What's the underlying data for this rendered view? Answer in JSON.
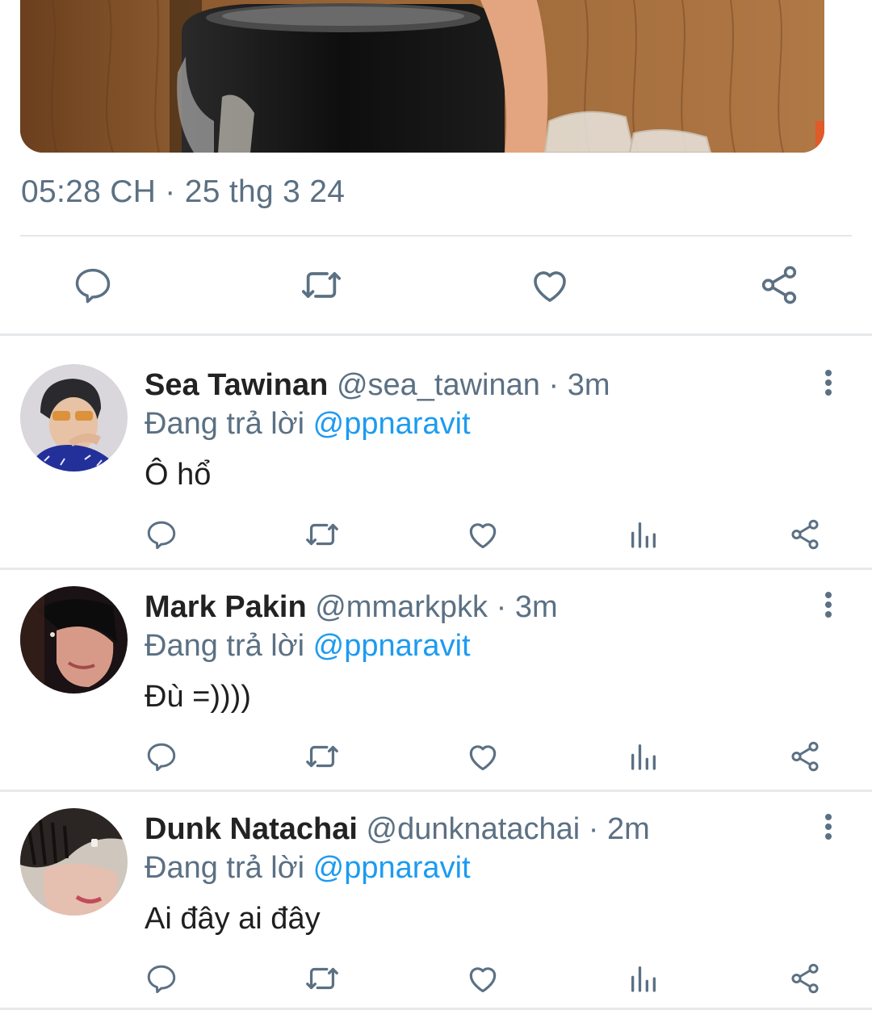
{
  "tweet": {
    "timestamp": "05:28 CH · 25 thg 3 24",
    "actions": [
      "reply-icon",
      "retweet-icon",
      "like-icon",
      "share-icon"
    ]
  },
  "replies": [
    {
      "name": "Sea Tawinan",
      "handle": "@sea_tawinan",
      "separator": "·",
      "time": "3m",
      "replying_prefix": "Đang trả lời",
      "replying_to": "@ppnaravit",
      "text": "Ô hổ"
    },
    {
      "name": "Mark Pakin",
      "handle": "@mmarkpkk",
      "separator": "·",
      "time": "3m",
      "replying_prefix": "Đang trả lời",
      "replying_to": "@ppnaravit",
      "text": "Đù =))))"
    },
    {
      "name": "Dunk Natachai",
      "handle": "@dunknatachai",
      "separator": "·",
      "time": "2m",
      "replying_prefix": "Đang trả lời",
      "replying_to": "@ppnaravit",
      "text": "Ai đây ai đây"
    }
  ],
  "reply_actions": [
    "reply-icon",
    "retweet-icon",
    "like-icon",
    "views-icon",
    "share-icon"
  ],
  "colors": {
    "text_primary": "#222222",
    "text_secondary": "#5b7083",
    "link": "#1d9bf0",
    "icon": "#5b7083",
    "divider": "#e6e9eb"
  }
}
